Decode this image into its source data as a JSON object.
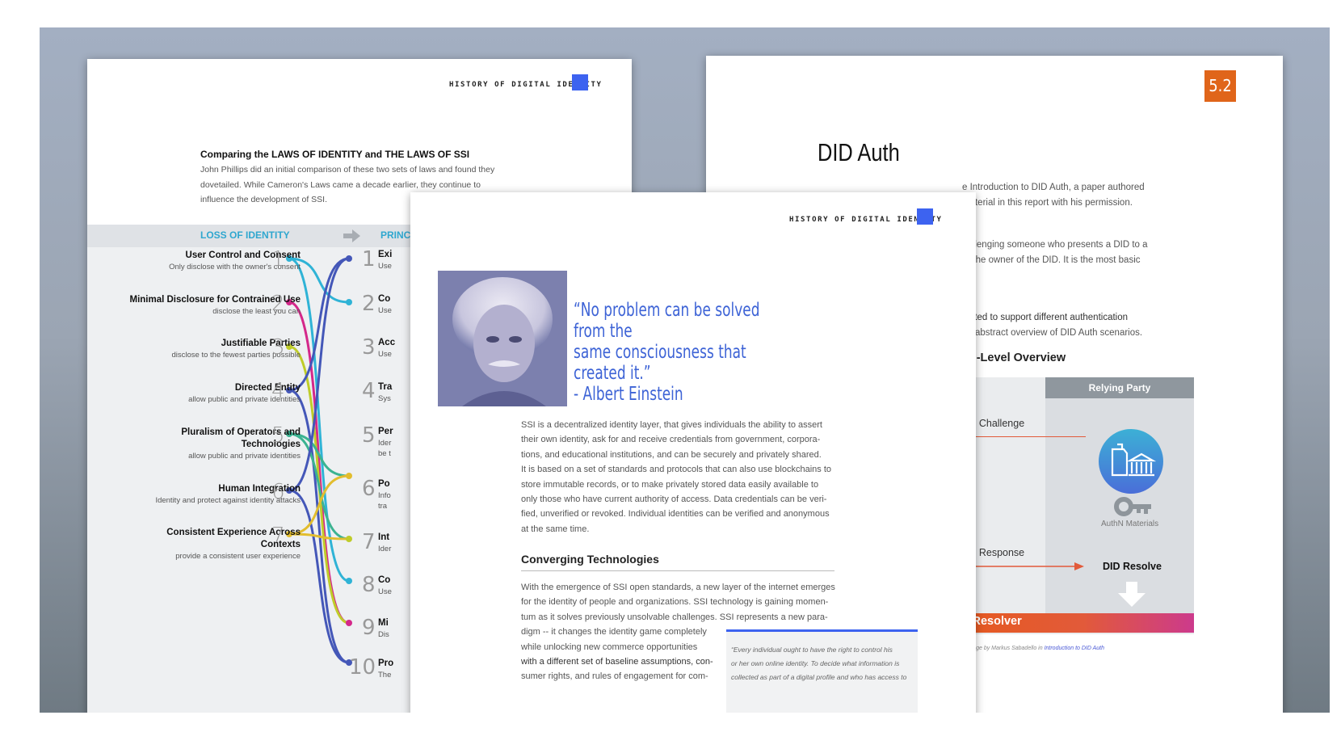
{
  "left_page": {
    "header": "HISTORY OF DIGITAL IDENTITY",
    "title": "Comparing the LAWS OF IDENTITY and THE LAWS OF SSI",
    "intro": "John Phillips did an initial comparison of these two sets of laws and found they dovetailed. While Cameron's Laws came a decade earlier, they continue to influence the development of SSI.",
    "band_left": "LOSS OF IDENTITY",
    "band_right": "PRINC",
    "laws": [
      {
        "num": "1",
        "title": "User Control and Consent",
        "sub": "Only disclose with the owner's consent"
      },
      {
        "num": "2",
        "title": "Minimal Disclosure for Contrained Use",
        "sub": "disclose the least you can"
      },
      {
        "num": "3",
        "title": "Justifiable Parties",
        "sub": "disclose to the fewest parties possible"
      },
      {
        "num": "4",
        "title": "Directed Entity",
        "sub": "allow public and private identities"
      },
      {
        "num": "5",
        "title": "Pluralism of Operators and Technologies",
        "sub": "allow public and private identities"
      },
      {
        "num": "6",
        "title": "Human Integration",
        "sub": "Identity and protect against identity attacks"
      },
      {
        "num": "7",
        "title": "Consistent Experience Across Contexts",
        "sub": "provide a consistent user experience"
      }
    ],
    "principles": [
      {
        "num": "1",
        "label": "Exi",
        "sub": "Use"
      },
      {
        "num": "2",
        "label": "Co",
        "sub": "Use"
      },
      {
        "num": "3",
        "label": "Acc",
        "sub": "Use"
      },
      {
        "num": "4",
        "label": "Tra",
        "sub": "Sys"
      },
      {
        "num": "5",
        "label": "Per",
        "sub": "Ider"
      },
      {
        "num": "6",
        "label": "Po",
        "sub": "Info"
      },
      {
        "num": "7",
        "label": "Int",
        "sub": "Ider"
      },
      {
        "num": "8",
        "label": "Co",
        "sub": "Use"
      },
      {
        "num": "9",
        "label": "Mi",
        "sub": "Dis"
      },
      {
        "num": "10",
        "label": "Pro",
        "sub": "The"
      }
    ],
    "principle_extra": {
      "p5": "be t",
      "p6": "tra"
    },
    "colors": {
      "c1": "#2fb3d6",
      "c2": "#d4288a",
      "c3": "#bfcc2a",
      "c4": "#4457b8",
      "c5": "#3bb391",
      "c6": "#4457b8",
      "c7": "#e2bd2e"
    }
  },
  "right_page": {
    "badge": "5.2",
    "title": "DID Auth",
    "p1": [
      "e Introduction to DID Auth, a paper authored",
      "material in this report with his permission."
    ],
    "p2": [
      "hallenging someone who presents a DID to a",
      "re the owner of the DID. It is the most basic"
    ],
    "p3": [
      "ulated to support different authentication",
      "an abstract overview of DID Auth scenarios."
    ],
    "overview": "gh-Level Overview",
    "relying_party": "Relying Party",
    "challenge": "uth Challenge",
    "response": "uth Response",
    "authn": "AuthN Materials",
    "did_resolve": "DID Resolve",
    "resolver": "D Resolver",
    "caption_pre": "n image by Markus Sabadello in ",
    "caption_link": "Introduction to DID Auth",
    "colors": {
      "badge": "#e0651a",
      "accent": "#e25a3a"
    }
  },
  "center_page": {
    "header": "HISTORY OF DIGITAL IDENTITY",
    "quote": [
      "“No problem can be solved from the",
      "same consciousness that created it.”",
      "- Albert Einstein"
    ],
    "para1": [
      "SSI is a decentralized identity layer, that gives individuals the ability to assert",
      "their own identity, ask for and receive credentials from government, corpora-",
      "tions, and educational institutions, and can be securely and privately shared.",
      "It is based on a set of standards and protocols that can also use blockchains to",
      "store immutable records, or to make privately stored data easily available to",
      "only those who have current authority of access. Data credentials can be veri-",
      "fied, unverified or revoked. Individual identities can be verified and anonymous",
      "at the same time."
    ],
    "heading": "Converging Technologies",
    "para2_full": [
      "With the emergence of SSI open standards, a new layer of the internet emerges",
      "for the identity of people and organizations. SSI technology is gaining momen-",
      "tum as it solves previously unsolvable challenges. SSI represents a new para-"
    ],
    "para2_narrow": [
      "digm -- it changes the identity game completely",
      "while unlocking new commerce opportunities",
      "with a different set of baseline assumptions, con-",
      "sumer rights, and rules of engagement for com-"
    ],
    "pullquote": [
      "“Every individual ought to have the right to control his",
      "or her own online identity. To decide what information is",
      "collected as part of a digital profile and who has access to"
    ],
    "colors": {
      "accent": "#3d63f0",
      "quote": "#3d63d6"
    }
  }
}
